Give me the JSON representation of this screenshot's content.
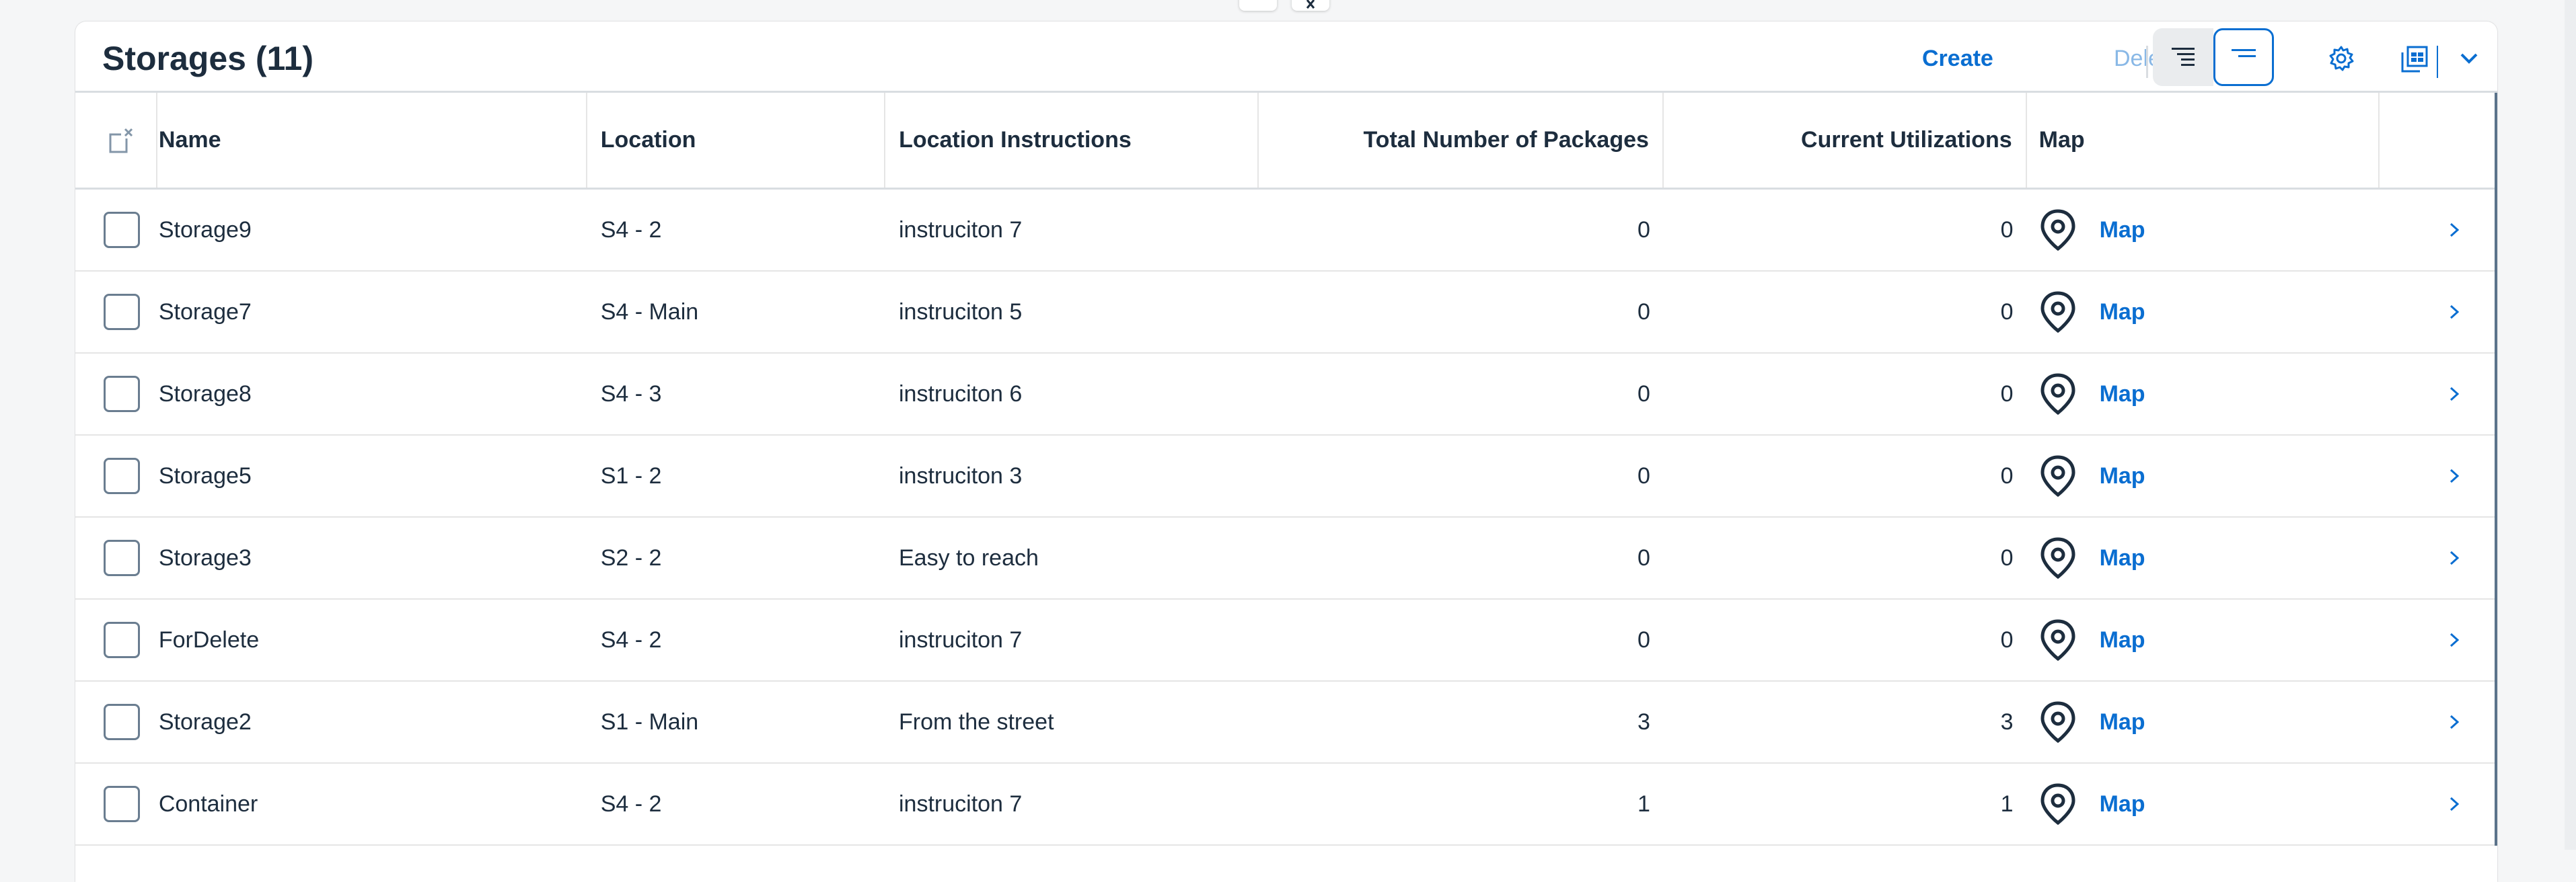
{
  "header": {
    "title": "Storages (11)",
    "create_label": "Create",
    "delete_label": "Delete"
  },
  "table": {
    "columns": [
      "Name",
      "Location",
      "Location Instructions",
      "Total Number of Packages",
      "Current Utilizations",
      "Map"
    ],
    "rows": [
      {
        "name": "Storage9",
        "location": "S4 - 2",
        "instructions": "instruciton 7",
        "total": "0",
        "util": "0",
        "map": "Map"
      },
      {
        "name": "Storage7",
        "location": "S4 - Main",
        "instructions": "instruciton 5",
        "total": "0",
        "util": "0",
        "map": "Map"
      },
      {
        "name": "Storage8",
        "location": "S4 - 3",
        "instructions": "instruciton 6",
        "total": "0",
        "util": "0",
        "map": "Map"
      },
      {
        "name": "Storage5",
        "location": "S1 - 2",
        "instructions": "instruciton 3",
        "total": "0",
        "util": "0",
        "map": "Map"
      },
      {
        "name": "Storage3",
        "location": "S2 - 2",
        "instructions": "Easy to reach",
        "total": "0",
        "util": "0",
        "map": "Map"
      },
      {
        "name": "ForDelete",
        "location": "S4 - 2",
        "instructions": "instruciton 7",
        "total": "0",
        "util": "0",
        "map": "Map"
      },
      {
        "name": "Storage2",
        "location": "S1 - Main",
        "instructions": "From the street",
        "total": "3",
        "util": "3",
        "map": "Map"
      },
      {
        "name": "Container",
        "location": "S4 - 2",
        "instructions": "instruciton 7",
        "total": "1",
        "util": "1",
        "map": "Map"
      }
    ]
  },
  "colors": {
    "accent": "#0a6ed1",
    "text": "#1d2d3e",
    "disabled": "#89b8e6"
  },
  "icons": {
    "select_all": "clear-selection-icon",
    "condensed": "text-align-right-icon",
    "group": "group-header-icon",
    "settings": "gear-icon",
    "export": "export-spreadsheet-icon",
    "menu": "chevron-down-icon",
    "map": "map-pin-icon",
    "navigate": "chevron-right-icon"
  }
}
